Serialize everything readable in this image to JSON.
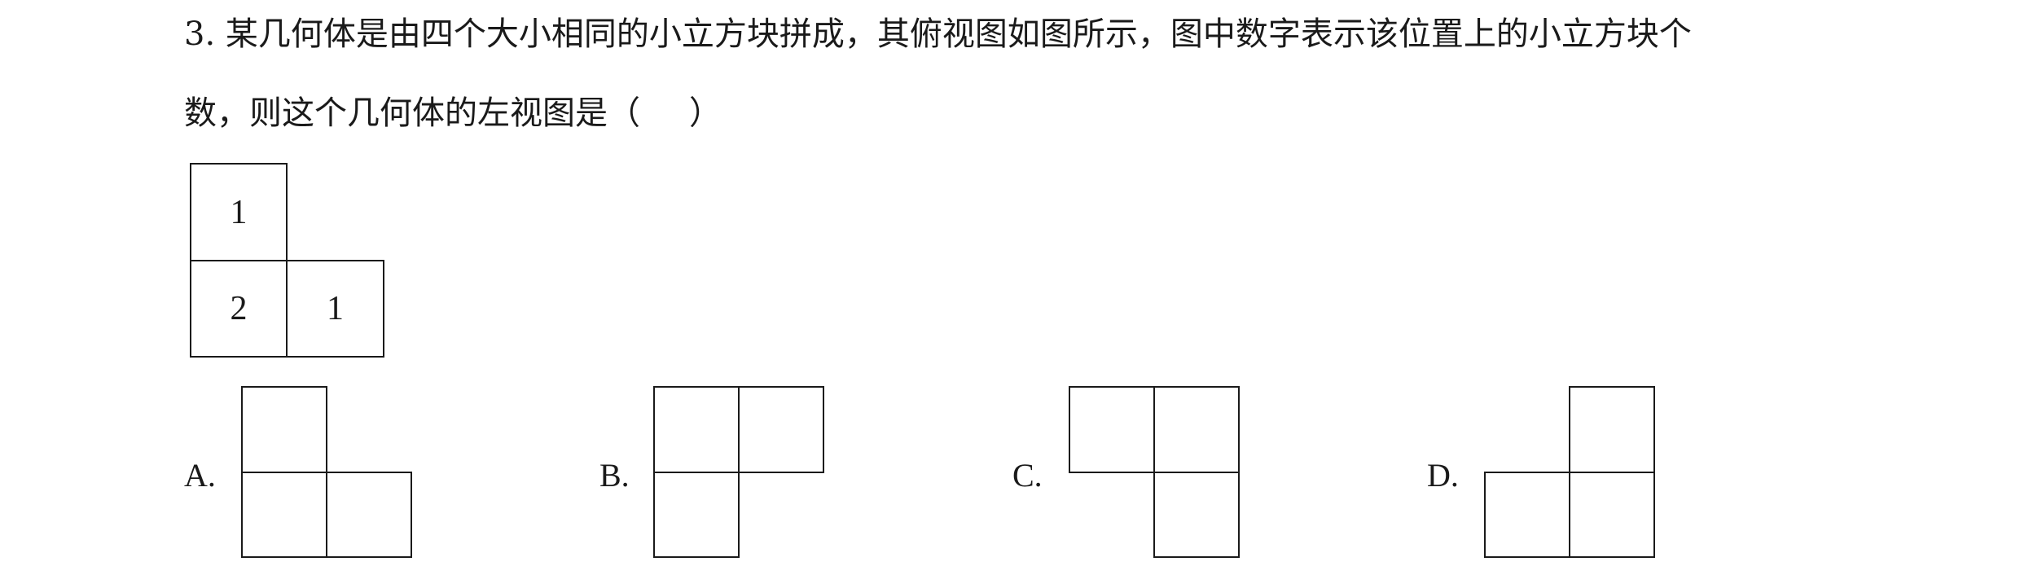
{
  "question": {
    "line1": "3. 某几何体是由四个大小相同的小立方块拼成，其俯视图如图所示，图中数字表示该位置上的小立方块个",
    "line2_start": "数，则这个几何体的左视图是（",
    "line2_end": "）"
  },
  "top_view": {
    "cells": [
      {
        "row": 0,
        "col": 0,
        "number": "1"
      },
      {
        "row": 1,
        "col": 0,
        "number": "2"
      },
      {
        "row": 1,
        "col": 1,
        "number": "1"
      }
    ]
  },
  "options": [
    {
      "label": "A.",
      "squares": "top-left, bottom-left, bottom-right"
    },
    {
      "label": "B.",
      "squares": "top-left, top-right, bottom-left"
    },
    {
      "label": "C.",
      "squares": "top-left, top-right, bottom-right"
    },
    {
      "label": "D.",
      "squares": "top-right, bottom-left, bottom-right"
    }
  ]
}
